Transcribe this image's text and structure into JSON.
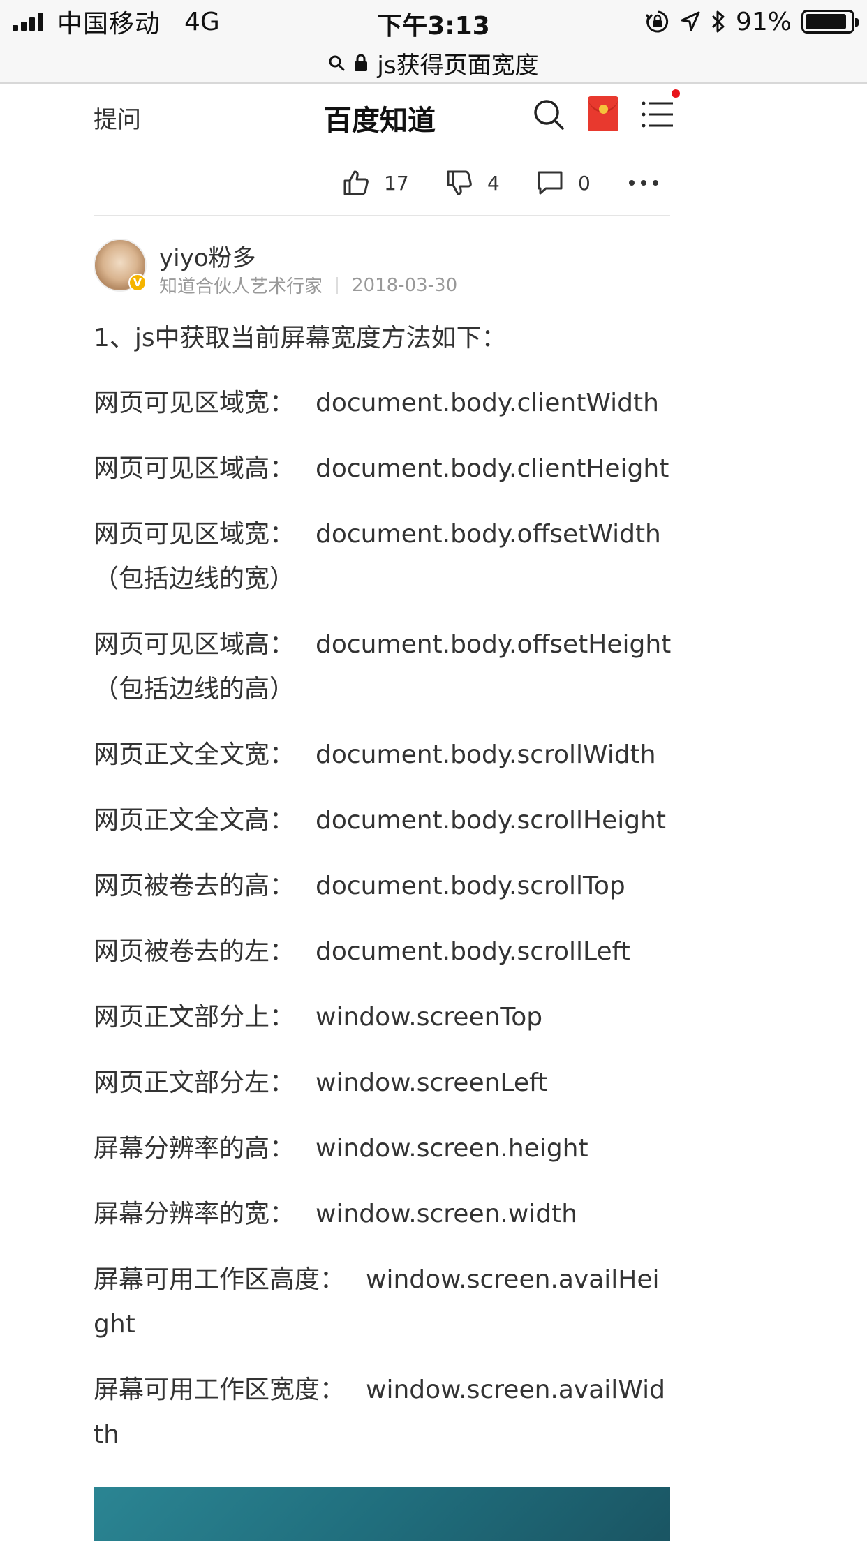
{
  "status_bar": {
    "carrier": "中国移动",
    "network": "4G",
    "time": "下午3:13",
    "battery": "91%",
    "battery_level": 0.91
  },
  "url_bar": {
    "title": "js获得页面宽度"
  },
  "header": {
    "ask_label": "提问",
    "brand": "百度知道"
  },
  "actions": {
    "likes": "17",
    "dislikes": "4",
    "comments": "0"
  },
  "author": {
    "name": "yiyo粉多",
    "title": "知道合伙人艺术行家",
    "date": "2018-03-30",
    "badge": "V"
  },
  "article": {
    "intro": "1、js中获取当前屏幕宽度方法如下：",
    "rows": [
      {
        "label": "网页可见区域宽：",
        "value": "document.body.clientWidth"
      },
      {
        "label": "网页可见区域高：",
        "value": "document.body.clientHeight"
      },
      {
        "label": "网页可见区域宽：",
        "value": "document.body.offsetWidth （包括边线的宽）"
      },
      {
        "label": "网页可见区域高：",
        "value": "document.body.offsetHeight （包括边线的高）"
      },
      {
        "label": "网页正文全文宽：",
        "value": "document.body.scrollWidth"
      },
      {
        "label": "网页正文全文高：",
        "value": "document.body.scrollHeight"
      },
      {
        "label": "网页被卷去的高：",
        "value": "document.body.scrollTop"
      },
      {
        "label": "网页被卷去的左：",
        "value": "document.body.scrollLeft"
      },
      {
        "label": "网页正文部分上：",
        "value": "window.screenTop"
      },
      {
        "label": "网页正文部分左：",
        "value": "window.screenLeft"
      },
      {
        "label": "屏幕分辨率的高：",
        "value": "window.screen.height"
      },
      {
        "label": "屏幕分辨率的宽：",
        "value": "window.screen.width"
      },
      {
        "label": "屏幕可用工作区高度：",
        "value": "window.screen.availHeight"
      },
      {
        "label": "屏幕可用工作区宽度：",
        "value": "window.screen.availWidth"
      }
    ]
  },
  "colors": {
    "accent_red": "#e8392e",
    "notification_dot": "#e8141b",
    "teaser": "#206e7d"
  }
}
